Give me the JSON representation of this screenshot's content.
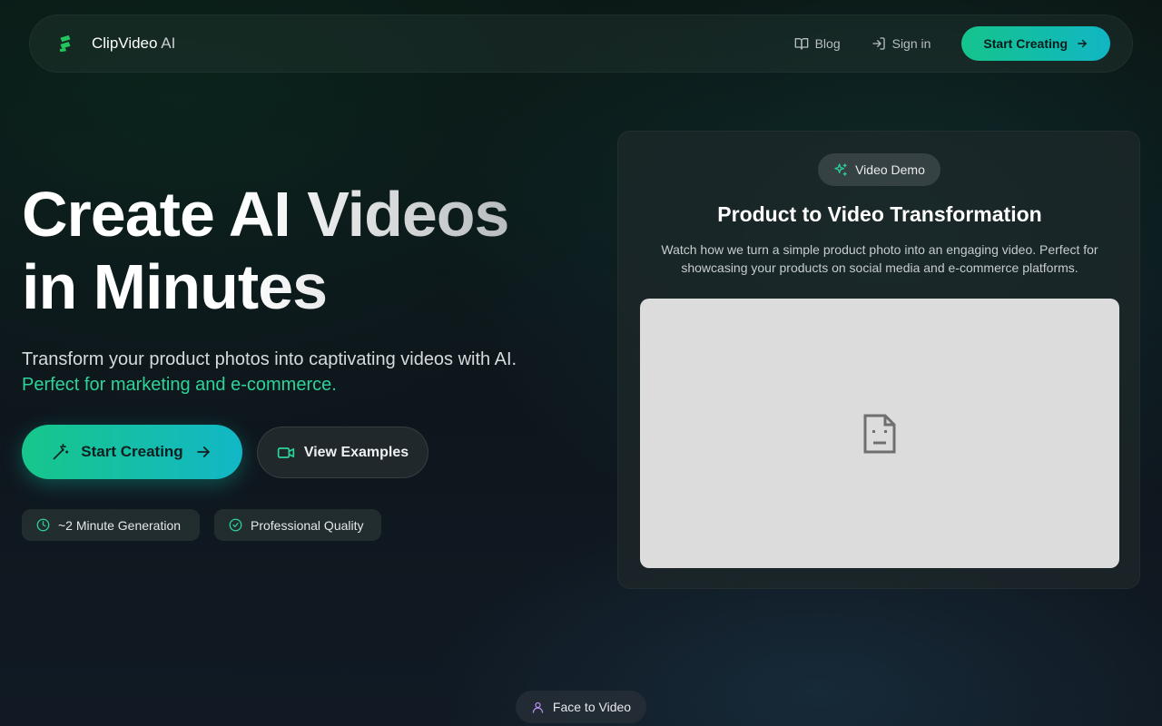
{
  "nav": {
    "brand_name": "ClipVideo",
    "brand_suffix": " AI",
    "blog_label": "Blog",
    "signin_label": "Sign in",
    "cta_label": "Start Creating"
  },
  "hero": {
    "title_line1": "Create AI Videos",
    "title_line2": "in Minutes",
    "subtitle": "Transform your product photos into captivating videos with AI.",
    "subtitle_highlight": "Perfect for marketing and e-commerce.",
    "primary_button": "Start Creating",
    "secondary_button": "View Examples",
    "features": [
      "~2 Minute Generation",
      "Professional Quality"
    ]
  },
  "demo": {
    "badge": "Video Demo",
    "title": "Product to Video Transformation",
    "description": "Watch how we turn a simple product photo into an engaging video. Perfect for showcasing your products on social media and e-commerce platforms."
  },
  "bottom": {
    "pill_label": "Face to Video"
  },
  "colors": {
    "accent_green": "#2dd49a",
    "accent_teal": "#12b7c6",
    "badge_icon": "#2ecc9a",
    "face_icon": "#b48cf0"
  },
  "icons": {
    "brand": "clipvideo-logo-icon",
    "blog": "book-icon",
    "signin": "sign-in-icon",
    "arrow": "arrow-right-icon",
    "wand": "magic-wand-icon",
    "video": "video-camera-icon",
    "clock": "clock-icon",
    "check": "check-circle-icon",
    "sparkles": "sparkles-icon",
    "broken_media": "broken-media-icon",
    "user": "user-icon"
  }
}
